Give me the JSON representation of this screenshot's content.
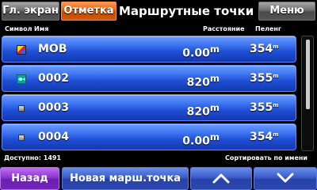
{
  "topbar": {
    "home_label": "Гл. экран",
    "mark_label": "Отметка",
    "title": "Маршрутные точки",
    "menu_label": "Меню"
  },
  "columns": {
    "symbol": "Символ",
    "name": "Имя",
    "distance": "Расстояние",
    "bearing": "Пеленг"
  },
  "waypoints": [
    {
      "symbol": "mob-icon",
      "name": "MOB",
      "distance": "0.00",
      "distance_unit": "m",
      "bearing": "354",
      "bearing_unit": "m"
    },
    {
      "symbol": "fish-icon",
      "name": "0002",
      "distance": "820",
      "distance_unit": "m",
      "bearing": "355",
      "bearing_unit": "m"
    },
    {
      "symbol": "waypoint-dot-icon",
      "name": "0003",
      "distance": "820",
      "distance_unit": "m",
      "bearing": "355",
      "bearing_unit": "m"
    },
    {
      "symbol": "waypoint-dot-icon",
      "name": "0004",
      "distance": "0.00",
      "distance_unit": "m",
      "bearing": "354",
      "bearing_unit": "m"
    }
  ],
  "footer": {
    "available": "Доступно: 1491",
    "sort": "Сортировать по имени"
  },
  "bottombar": {
    "back_label": "Назад",
    "new_label": "Новая марш.точка",
    "up_icon": "chevron-up-icon",
    "down_icon": "chevron-down-icon"
  },
  "colors": {
    "row_blue": "#1f4fd6",
    "mark_orange": "#e06010",
    "back_purple": "#8c35d0"
  }
}
